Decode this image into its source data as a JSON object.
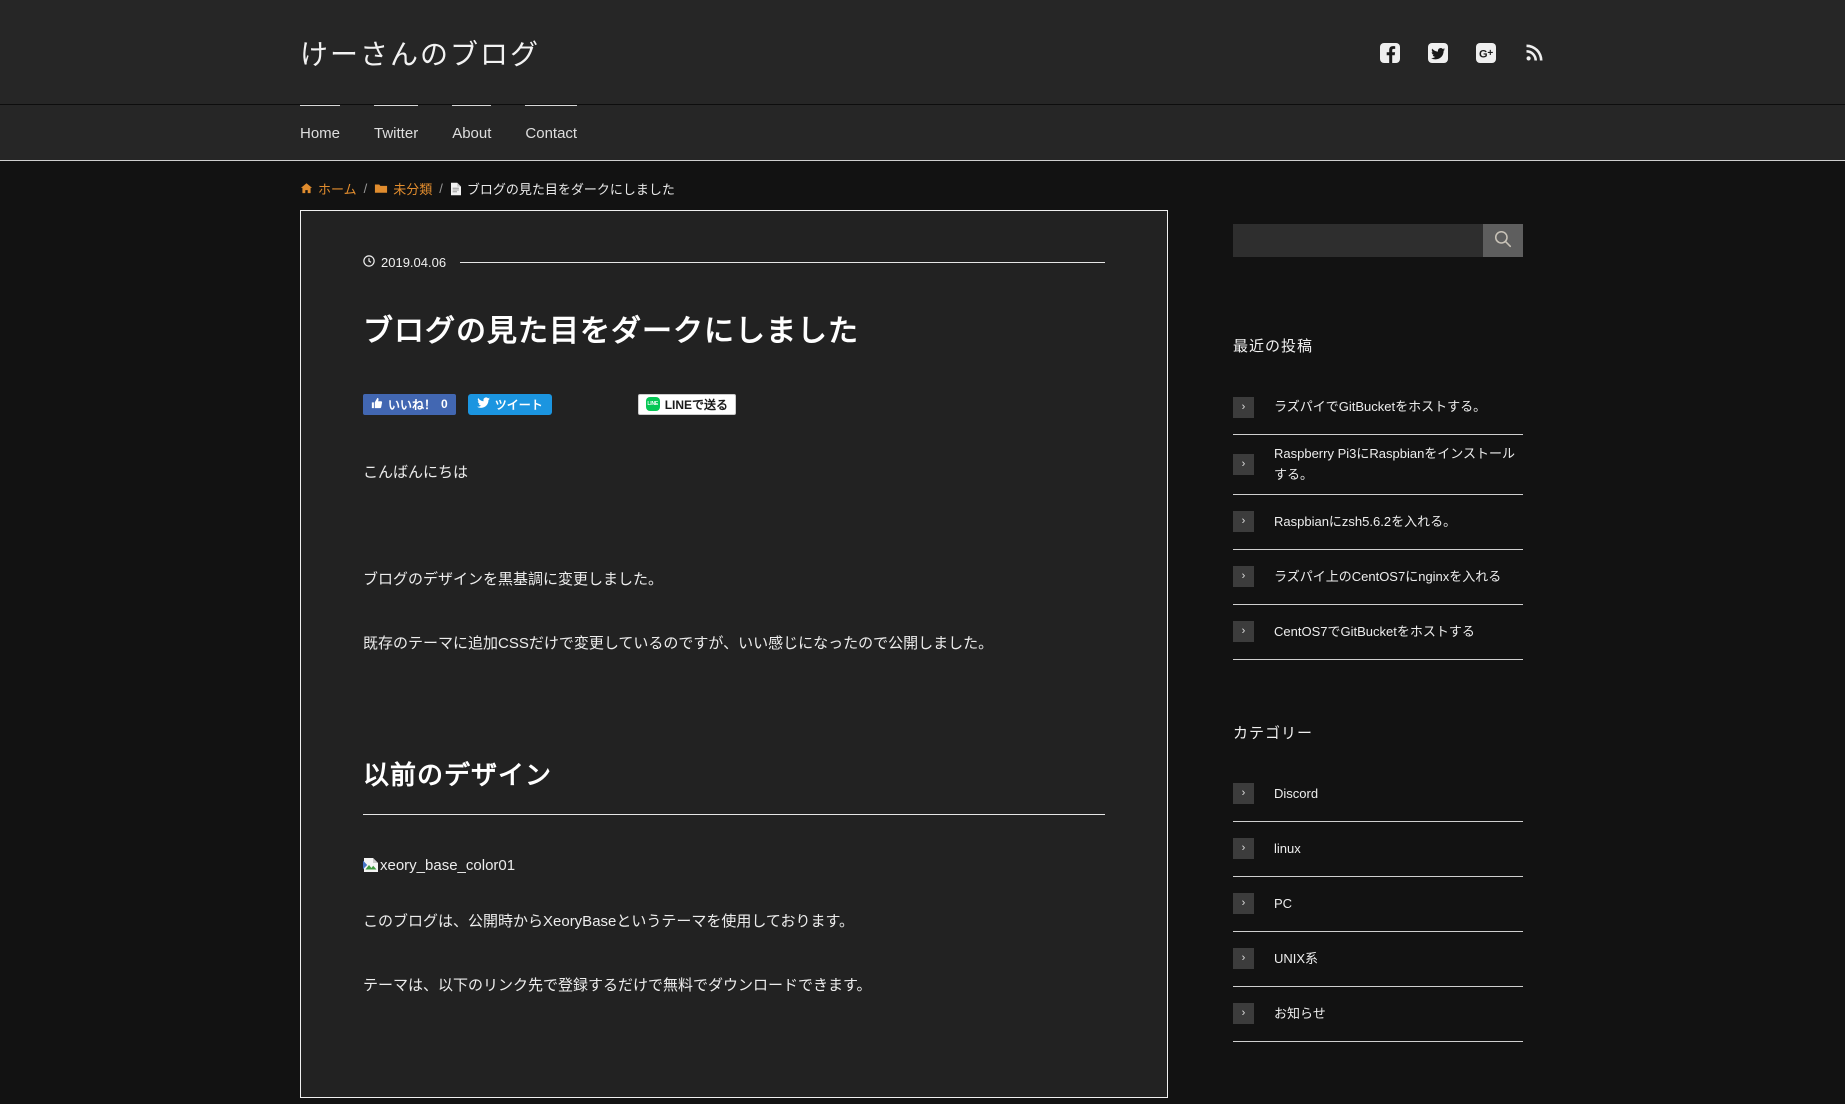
{
  "header": {
    "site_title": "けーさんのブログ",
    "social": [
      {
        "name": "facebook-icon",
        "label": "Facebook"
      },
      {
        "name": "twitter-icon",
        "label": "Twitter"
      },
      {
        "name": "google-plus-icon",
        "label": "Google+"
      },
      {
        "name": "rss-icon",
        "label": "RSS"
      }
    ]
  },
  "nav": {
    "items": [
      {
        "label": "Home"
      },
      {
        "label": "Twitter"
      },
      {
        "label": "About"
      },
      {
        "label": "Contact"
      }
    ]
  },
  "breadcrumb": {
    "home": "ホーム",
    "category": "未分類",
    "current": "ブログの見た目をダークにしました",
    "separator": "/"
  },
  "post": {
    "date": "2019.04.06",
    "title": "ブログの見た目をダークにしました",
    "share": {
      "facebook_label": "いいね！",
      "facebook_count": "0",
      "twitter_label": "ツイート",
      "line_label": "LINEで送る",
      "line_badge": "LINE"
    },
    "paragraphs": [
      "こんばんにちは",
      "ブログのデザインを黒基調に変更しました。",
      "既存のテーマに追加CSSだけで変更しているのですが、いい感じになったので公開しました。"
    ],
    "section_heading": "以前のデザイン",
    "image_alt": "xeory_base_color01",
    "paragraphs_after": [
      "このブログは、公開時からXeoryBaseというテーマを使用しております。",
      "テーマは、以下のリンク先で登録するだけで無料でダウンロードできます。"
    ]
  },
  "sidebar": {
    "search": {
      "value": "",
      "placeholder": ""
    },
    "recent": {
      "title": "最近の投稿",
      "items": [
        {
          "label": "ラズパイでGitBucketをホストする。"
        },
        {
          "label": "Raspberry Pi3にRaspbianをインストールする。"
        },
        {
          "label": "Raspbianにzsh5.6.2を入れる。"
        },
        {
          "label": "ラズパイ上のCentOS7にnginxを入れる"
        },
        {
          "label": "CentOS7でGitBucketをホストする"
        }
      ]
    },
    "categories": {
      "title": "カテゴリー",
      "items": [
        {
          "label": "Discord"
        },
        {
          "label": "linux"
        },
        {
          "label": "PC"
        },
        {
          "label": "UNIX系"
        },
        {
          "label": "お知らせ"
        }
      ]
    }
  },
  "colors": {
    "page_bg": "#121212",
    "header_bg": "#262626",
    "card_bg": "#222222",
    "accent_orange": "#e08c2e",
    "facebook_blue": "#4267b2",
    "twitter_blue": "#1b95e0",
    "line_green": "#06c755"
  }
}
